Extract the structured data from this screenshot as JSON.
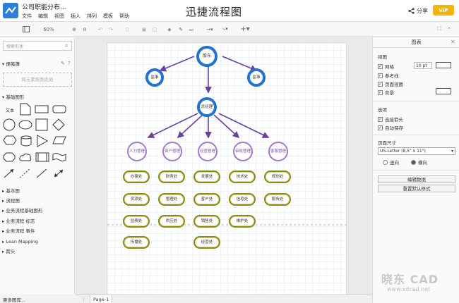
{
  "header": {
    "doc_title": "公司职能分布...",
    "menu": [
      "文件",
      "编辑",
      "视图",
      "插入",
      "排列",
      "模板",
      "帮助"
    ],
    "center_title": "迅捷流程图",
    "share_label": "分享",
    "vip_label": "VIP"
  },
  "toolbar": {
    "zoom": "60%"
  },
  "sidebar": {
    "search_placeholder": "搜索形状",
    "scratchpad": "便笺簿",
    "drop_hint": "将元素拖到此处",
    "basic_shapes": "基础图形",
    "text_shape": "文本",
    "sections": [
      "基本图",
      "流程图",
      "业务流程基础图形",
      "业务流程 标志",
      "业务流程 事件",
      "Lean Mapping",
      "箭头"
    ],
    "more_shapes": "更多图库..."
  },
  "diagram": {
    "top": "股东",
    "left_ctl": "监事",
    "right_ctl": "监事",
    "mid": "总经理",
    "departments": [
      "人力管理",
      "资产管理",
      "经营管理",
      "审批管理",
      "客服管理"
    ],
    "col1": [
      "办事处",
      "资源处",
      "监察处",
      "传播处"
    ],
    "col2": [
      "财务处",
      "管理处",
      "供应处"
    ],
    "col3": [
      "发展处",
      "客户处",
      "销售处",
      "经营处"
    ],
    "col4": [
      "技术处",
      "信息处",
      "维护处"
    ],
    "col5": [
      "规划处",
      "服务处"
    ]
  },
  "bottom": {
    "page_tab": "Page-1"
  },
  "rightpanel": {
    "title": "图表",
    "view_label": "视图",
    "grid": "网格",
    "grid_size": "10 pt",
    "guides": "参考线",
    "page_view": "页面视图",
    "background": "背景",
    "options_label": "选项",
    "connect_arrows": "连接箭头",
    "autosave": "自动保存",
    "page_size_label": "页面尺寸",
    "page_size": "US-Letter (8,5\" x 11\")",
    "portrait": "竖向",
    "landscape": "横向",
    "edit_data": "编辑数据",
    "reset_style": "重置默认样式"
  },
  "watermark": {
    "brand": "晓东 CAD",
    "url": "www.xdcad.net"
  }
}
